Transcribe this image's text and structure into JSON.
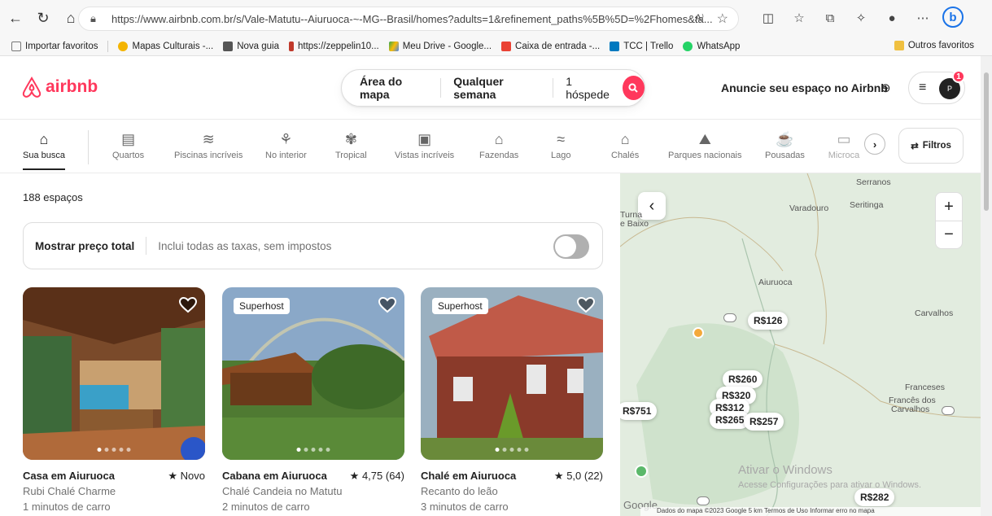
{
  "browser": {
    "url": "https://www.airbnb.com.br/s/Vale-Matutu--Aiuruoca-~-MG--Brasil/homes?adults=1&refinement_paths%5B%5D=%2Fhomes&ta...",
    "bookmarks": [
      "Importar favoritos",
      "Mapas Culturais -...",
      "Nova guia",
      "https://zeppelin10...",
      "Meu Drive - Google...",
      "Caixa de entrada -...",
      "TCC | Trello",
      "WhatsApp"
    ],
    "other_favorites": "Outros favoritos"
  },
  "header": {
    "logo": "airbnb",
    "search": {
      "location": "Área do mapa",
      "dates": "Qualquer semana",
      "guests": "1 hóspede"
    },
    "host_link": "Anuncie seu espaço no Airbnb",
    "avatar_initial": "P",
    "notification_count": "1"
  },
  "categories": [
    {
      "label": "Sua busca",
      "icon": "home-search-icon",
      "glyph": "⌂"
    },
    {
      "label": "Quartos",
      "icon": "bed-icon",
      "glyph": "▤"
    },
    {
      "label": "Piscinas incríveis",
      "icon": "pool-icon",
      "glyph": "≋"
    },
    {
      "label": "No interior",
      "icon": "tractor-icon",
      "glyph": "⚘"
    },
    {
      "label": "Tropical",
      "icon": "palm-icon",
      "glyph": "✾"
    },
    {
      "label": "Vistas incríveis",
      "icon": "view-icon",
      "glyph": "▣"
    },
    {
      "label": "Fazendas",
      "icon": "farm-icon",
      "glyph": "⌂"
    },
    {
      "label": "Lago",
      "icon": "lake-icon",
      "glyph": "≈"
    },
    {
      "label": "Chalés",
      "icon": "cabin-icon",
      "glyph": "⌂"
    },
    {
      "label": "Parques nacionais",
      "icon": "park-icon",
      "glyph": "⛰"
    },
    {
      "label": "Pousadas",
      "icon": "bnb-icon",
      "glyph": "☕"
    },
    {
      "label": "Microca",
      "icon": "tiny-home-icon",
      "glyph": "▭"
    }
  ],
  "filters_label": "Filtros",
  "results": {
    "count": "188 espaços",
    "price_toggle_label": "Mostrar preço total",
    "price_toggle_sub": "Inclui todas as taxas, sem impostos"
  },
  "listings": [
    {
      "title": "Casa em Aiuruoca",
      "rating": "Novo",
      "subtitle": "Rubi Chalé Charme",
      "distance": "1 minutos de carro",
      "badge": ""
    },
    {
      "title": "Cabana em Aiuruoca",
      "rating": "4,75 (64)",
      "subtitle": "Chalé Candeia no Matutu",
      "distance": "2 minutos de carro",
      "badge": "Superhost"
    },
    {
      "title": "Chalé em Aiuruoca",
      "rating": "5,0 (22)",
      "subtitle": "Recanto do leão",
      "distance": "3 minutos de carro",
      "badge": "Superhost"
    }
  ],
  "map": {
    "places": [
      "Serranos",
      "Varadouro",
      "Seritinga",
      "Aiuruoca",
      "Carvalhos",
      "Franceses",
      "Francês dos",
      "Carvalhos",
      "Turna",
      "e Baixo"
    ],
    "prices": [
      "R$126",
      "R$260",
      "R$320",
      "R$312",
      "R$265",
      "R$257",
      "R$751",
      "R$282"
    ],
    "watermark_title": "Ativar o Windows",
    "watermark_sub": "Acesse Configurações para ativar o Windows.",
    "footer": "Dados do mapa ©2023 Google   5 km              Termos de Uso   Informar erro no mapa",
    "google": "Google"
  },
  "colors": {
    "brand": "#ff385c"
  }
}
